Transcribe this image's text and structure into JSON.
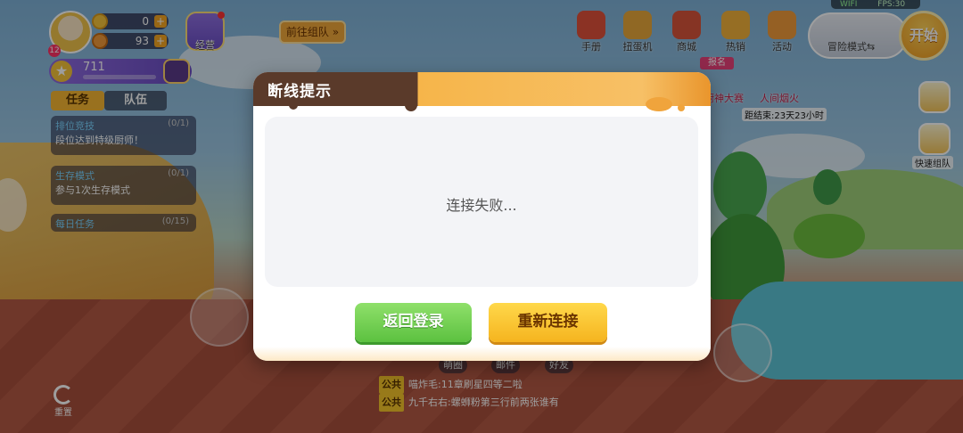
{
  "status_bar": {
    "wifi": "WIFI",
    "fps": "FPS:30"
  },
  "player": {
    "level": "12",
    "coins": "0",
    "gems": "93",
    "rank_points": "711"
  },
  "hud": {
    "business_label": "经营",
    "goto_team_label": "前往组队 »",
    "tabs": [
      "任务",
      "队伍"
    ],
    "tasks": [
      {
        "title": "排位竞技",
        "desc": "段位达到特级厨师！",
        "count": "(0/1)"
      },
      {
        "title": "生存模式",
        "desc": "参与1次生存模式",
        "count": "(0/1)"
      },
      {
        "title": "每日任务",
        "desc": "",
        "count": "(0/15)"
      }
    ],
    "top_menu": [
      "手册",
      "扭蛋机",
      "商城",
      "热销",
      "活动"
    ],
    "sign_tag": "报名",
    "events": [
      "厨神大赛",
      "人间烟火"
    ],
    "countdown": "距结束:23天23小时",
    "mode_label": "冒险模式⇆",
    "start_label": "开始",
    "quick_team_label": "快速组队",
    "bottom_bar": [
      "萌圈",
      "邮件",
      "好友"
    ],
    "reset_label": "重置",
    "chat": [
      {
        "channel": "公共",
        "text": "喵炸毛:11章刷星四等二啦"
      },
      {
        "channel": "公共",
        "text": "九千右右:螺蛳粉第三行前两张谁有"
      }
    ]
  },
  "dialog": {
    "title": "断线提示",
    "message": "连接失败...",
    "back_button": "返回登录",
    "reconnect_button": "重新连接"
  },
  "colors": {
    "dialog_header_dark": "#5a3a2a",
    "dialog_header_orange": "#f6b54a",
    "green_button": "#5cc140",
    "yellow_button": "#f5b41f"
  }
}
